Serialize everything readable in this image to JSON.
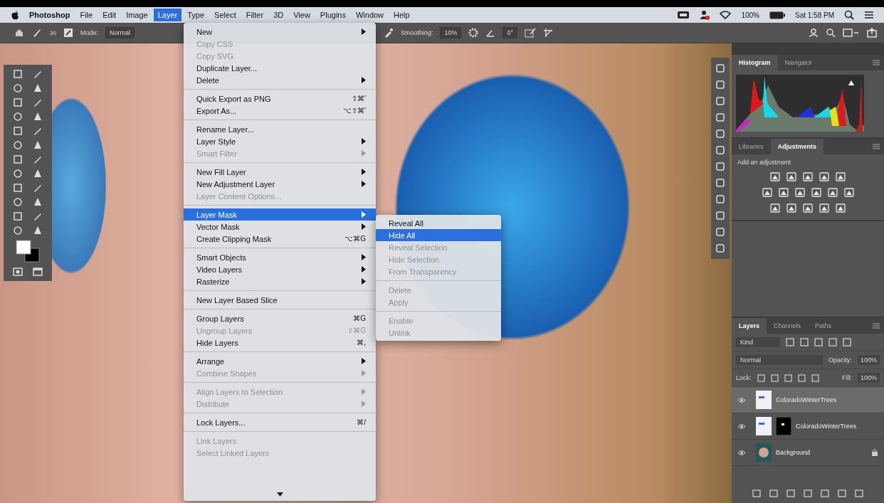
{
  "menubar": {
    "app_name": "Photoshop",
    "menus": [
      {
        "label": "File",
        "selected": false
      },
      {
        "label": "Edit",
        "selected": false
      },
      {
        "label": "Image",
        "selected": false
      },
      {
        "label": "Layer",
        "selected": true
      },
      {
        "label": "Type",
        "selected": false
      },
      {
        "label": "Select",
        "selected": false
      },
      {
        "label": "Filter",
        "selected": false
      },
      {
        "label": "3D",
        "selected": false
      },
      {
        "label": "View",
        "selected": false
      },
      {
        "label": "Plugins",
        "selected": false
      },
      {
        "label": "Window",
        "selected": false
      },
      {
        "label": "Help",
        "selected": false
      }
    ],
    "battery": "100%",
    "clock": "Sat 1:58 PM"
  },
  "options_bar": {
    "brush_size": "30",
    "mode_label": "Mode:",
    "mode_value": "Normal",
    "smoothing_label": "Smoothing:",
    "smoothing_value": "10%",
    "angle_value": "0°"
  },
  "layer_menu": {
    "items": [
      {
        "kind": "item",
        "label": "New",
        "submenu": true,
        "disabled": false,
        "selected": false
      },
      {
        "kind": "item",
        "label": "Copy CSS",
        "disabled": true,
        "selected": false
      },
      {
        "kind": "item",
        "label": "Copy SVG",
        "disabled": true,
        "selected": false
      },
      {
        "kind": "item",
        "label": "Duplicate Layer...",
        "disabled": false,
        "selected": false
      },
      {
        "kind": "item",
        "label": "Delete",
        "submenu": true,
        "disabled": false,
        "selected": false
      },
      {
        "kind": "separator"
      },
      {
        "kind": "item",
        "label": "Quick Export as PNG",
        "shortcut": "⇧⌘'",
        "disabled": false,
        "selected": false
      },
      {
        "kind": "item",
        "label": "Export As...",
        "shortcut": "⌥⇧⌘'",
        "disabled": false,
        "selected": false
      },
      {
        "kind": "separator"
      },
      {
        "kind": "item",
        "label": "Rename Layer...",
        "disabled": false,
        "selected": false
      },
      {
        "kind": "item",
        "label": "Layer Style",
        "submenu": true,
        "disabled": false,
        "selected": false
      },
      {
        "kind": "item",
        "label": "Smart Filter",
        "submenu": true,
        "disabled": true,
        "selected": false
      },
      {
        "kind": "separator"
      },
      {
        "kind": "item",
        "label": "New Fill Layer",
        "submenu": true,
        "disabled": false,
        "selected": false
      },
      {
        "kind": "item",
        "label": "New Adjustment Layer",
        "submenu": true,
        "disabled": false,
        "selected": false
      },
      {
        "kind": "item",
        "label": "Layer Content Options...",
        "disabled": true,
        "selected": false
      },
      {
        "kind": "separator"
      },
      {
        "kind": "item",
        "label": "Layer Mask",
        "submenu": true,
        "disabled": false,
        "selected": true
      },
      {
        "kind": "item",
        "label": "Vector Mask",
        "submenu": true,
        "disabled": false,
        "selected": false
      },
      {
        "kind": "item",
        "label": "Create Clipping Mask",
        "shortcut": "⌥⌘G",
        "disabled": false,
        "selected": false
      },
      {
        "kind": "separator"
      },
      {
        "kind": "item",
        "label": "Smart Objects",
        "submenu": true,
        "disabled": false,
        "selected": false
      },
      {
        "kind": "item",
        "label": "Video Layers",
        "submenu": true,
        "disabled": false,
        "selected": false
      },
      {
        "kind": "item",
        "label": "Rasterize",
        "submenu": true,
        "disabled": false,
        "selected": false
      },
      {
        "kind": "separator"
      },
      {
        "kind": "item",
        "label": "New Layer Based Slice",
        "disabled": false,
        "selected": false
      },
      {
        "kind": "separator"
      },
      {
        "kind": "item",
        "label": "Group Layers",
        "shortcut": "⌘G",
        "disabled": false,
        "selected": false
      },
      {
        "kind": "item",
        "label": "Ungroup Layers",
        "shortcut": "⇧⌘G",
        "disabled": true,
        "selected": false
      },
      {
        "kind": "item",
        "label": "Hide Layers",
        "shortcut": "⌘,",
        "disabled": false,
        "selected": false
      },
      {
        "kind": "separator"
      },
      {
        "kind": "item",
        "label": "Arrange",
        "submenu": true,
        "disabled": false,
        "selected": false
      },
      {
        "kind": "item",
        "label": "Combine Shapes",
        "submenu": true,
        "disabled": true,
        "selected": false
      },
      {
        "kind": "separator"
      },
      {
        "kind": "item",
        "label": "Align Layers to Selection",
        "submenu": true,
        "disabled": true,
        "selected": false
      },
      {
        "kind": "item",
        "label": "Distribute",
        "submenu": true,
        "disabled": true,
        "selected": false
      },
      {
        "kind": "separator"
      },
      {
        "kind": "item",
        "label": "Lock Layers...",
        "shortcut": "⌘/",
        "disabled": false,
        "selected": false
      },
      {
        "kind": "separator"
      },
      {
        "kind": "item",
        "label": "Link Layers",
        "disabled": true,
        "selected": false
      },
      {
        "kind": "item",
        "label": "Select Linked Layers",
        "disabled": true,
        "selected": false
      }
    ],
    "more_below": true
  },
  "layer_mask_submenu": {
    "items": [
      {
        "kind": "item",
        "label": "Reveal All",
        "disabled": false,
        "selected": false
      },
      {
        "kind": "item",
        "label": "Hide All",
        "disabled": false,
        "selected": true
      },
      {
        "kind": "item",
        "label": "Reveal Selection",
        "disabled": true,
        "selected": false
      },
      {
        "kind": "item",
        "label": "Hide Selection",
        "disabled": true,
        "selected": false
      },
      {
        "kind": "item",
        "label": "From Transparency",
        "disabled": true,
        "selected": false
      },
      {
        "kind": "separator"
      },
      {
        "kind": "item",
        "label": "Delete",
        "disabled": true,
        "selected": false
      },
      {
        "kind": "item",
        "label": "Apply",
        "disabled": true,
        "selected": false
      },
      {
        "kind": "separator"
      },
      {
        "kind": "item",
        "label": "Enable",
        "disabled": true,
        "selected": false
      },
      {
        "kind": "item",
        "label": "Unlink",
        "disabled": true,
        "selected": false
      }
    ]
  },
  "histogram_panel": {
    "tabs": [
      {
        "label": "Histogram",
        "selected": true
      },
      {
        "label": "Navigator",
        "selected": false
      }
    ]
  },
  "adjustments_panel": {
    "tabs": [
      {
        "label": "Libraries",
        "selected": false
      },
      {
        "label": "Adjustments",
        "selected": true
      }
    ],
    "hint": "Add an adjustment"
  },
  "layers_panel": {
    "tabs": [
      {
        "label": "Layers",
        "selected": true
      },
      {
        "label": "Channels",
        "selected": false
      },
      {
        "label": "Paths",
        "selected": false
      }
    ],
    "filter_value": "Kind",
    "blend_mode": "Normal",
    "opacity_label": "Opacity:",
    "opacity_value": "100%",
    "lock_label": "Lock:",
    "fill_label": "Fill:",
    "fill_value": "100%",
    "layers": [
      {
        "name": "ColoradoWinterTrees",
        "visible": true,
        "selected": true,
        "mask": false,
        "locked": false,
        "kind": "trees"
      },
      {
        "name": "ColoradoWinterTrees",
        "visible": true,
        "selected": false,
        "mask": true,
        "locked": false,
        "kind": "trees"
      },
      {
        "name": "Background",
        "visible": true,
        "selected": false,
        "mask": false,
        "locked": true,
        "kind": "portrait"
      }
    ]
  }
}
